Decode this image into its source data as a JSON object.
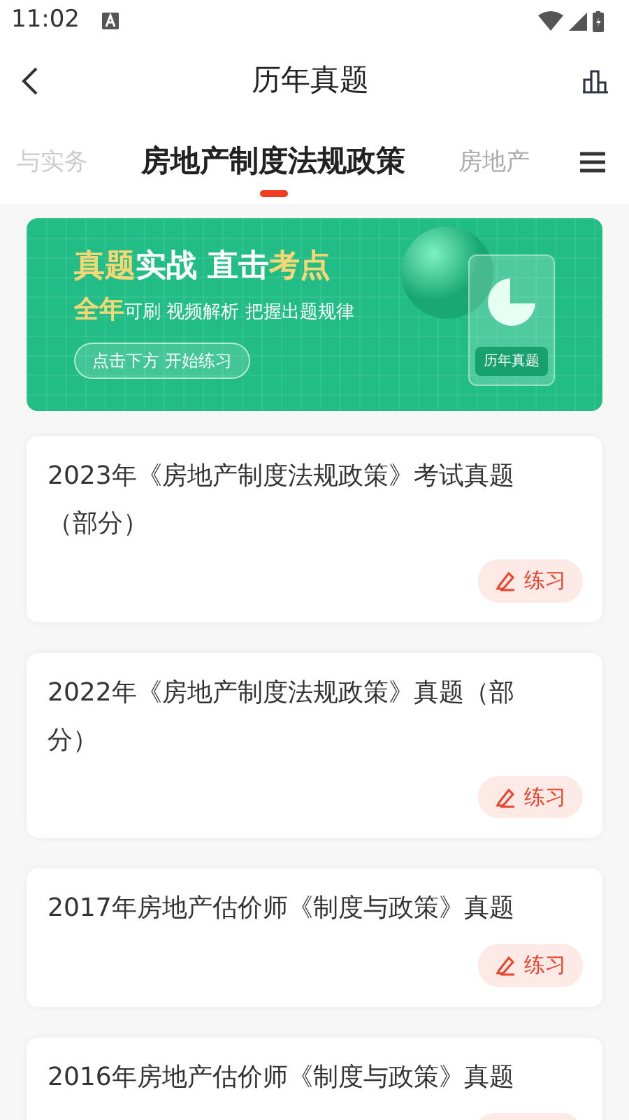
{
  "status_bar": {
    "time": "11:02"
  },
  "header": {
    "title": "历年真题"
  },
  "tabs": [
    {
      "label": "与实务",
      "selected": false
    },
    {
      "label": "房地产制度法规政策",
      "selected": true
    },
    {
      "label": "房地产",
      "selected": false
    }
  ],
  "banner": {
    "headline": [
      {
        "text": "真题",
        "highlight": true
      },
      {
        "text": "实战 直击",
        "highlight": false
      },
      {
        "text": "考点",
        "highlight": true
      }
    ],
    "subline": [
      {
        "text": "全年",
        "highlight": true
      },
      {
        "text": "可刷 视频解析 把握出题规律",
        "highlight": false
      }
    ],
    "button": "点击下方 开始练习",
    "card_label": "历年真题"
  },
  "papers": [
    {
      "title": "2023年《房地产制度法规政策》考试真题（部分）",
      "action": "练习"
    },
    {
      "title": "2022年《房地产制度法规政策》真题（部分）",
      "action": "练习"
    },
    {
      "title": "2017年房地产估价师《制度与政策》真题",
      "action": "练习"
    },
    {
      "title": "2016年房地产估价师《制度与政策》真题"
    }
  ]
}
